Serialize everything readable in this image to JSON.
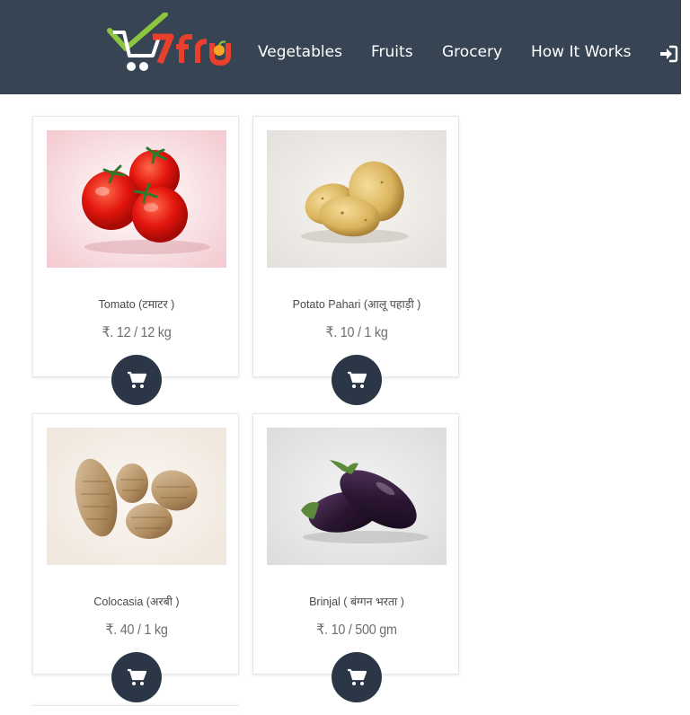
{
  "brand": {
    "logo_text": "7fru",
    "colors": {
      "navbar": "#364454",
      "logo_green": "#8cc63f",
      "logo_red": "#e8402d",
      "cart_button": "#2b3746"
    }
  },
  "nav": {
    "items": [
      {
        "label": "Vegetables"
      },
      {
        "label": "Fruits"
      },
      {
        "label": "Grocery"
      },
      {
        "label": "How It Works"
      }
    ],
    "login_icon": "sign-in-icon"
  },
  "products": [
    {
      "name": "Tomato (टमाटर )",
      "price": "₹. 12 / 12 kg",
      "image": "tomato-image",
      "cart_icon": "cart-icon"
    },
    {
      "name": "Potato Pahari (आलू पहाड़ी )",
      "price": "₹. 10 / 1 kg",
      "image": "potato-image",
      "cart_icon": "cart-icon"
    },
    {
      "name": "Colocasia (अरबी )",
      "price": "₹. 40 / 1 kg",
      "image": "colocasia-image",
      "cart_icon": "cart-icon"
    },
    {
      "name": "Brinjal ( बंग्गन भरता )",
      "price": "₹. 10 / 500 gm",
      "image": "brinjal-image",
      "cart_icon": "cart-icon"
    }
  ]
}
